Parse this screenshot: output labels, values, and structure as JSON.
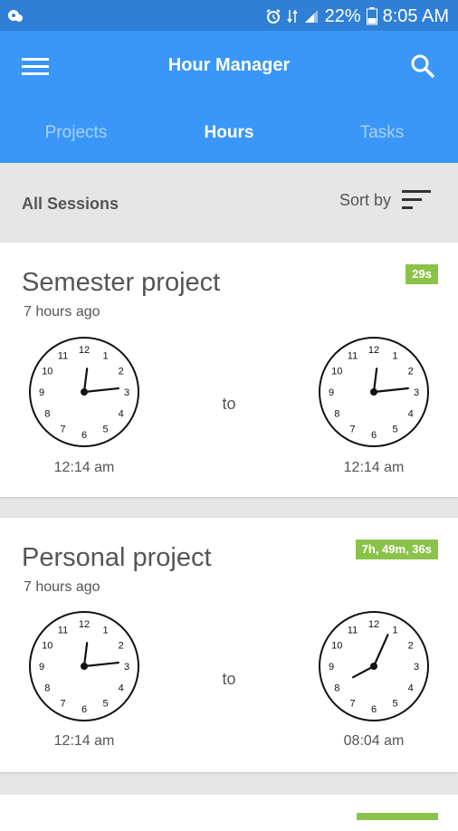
{
  "status_bar": {
    "battery": "22%",
    "time": "8:05 AM"
  },
  "app_bar": {
    "title": "Hour Manager"
  },
  "tabs": [
    {
      "label": "Projects",
      "active": false
    },
    {
      "label": "Hours",
      "active": true
    },
    {
      "label": "Tasks",
      "active": false
    }
  ],
  "sessions": {
    "header": "All Sessions",
    "sort_label": "Sort by",
    "items": [
      {
        "name": "Semester project",
        "ago": "7 hours ago",
        "duration": "29s",
        "start_time": "12:14 am",
        "to_label": "to",
        "end_time": "12:14 am",
        "start_clock": {
          "hours": 12,
          "minutes": 14
        },
        "end_clock": {
          "hours": 12,
          "minutes": 14
        }
      },
      {
        "name": "Personal project",
        "ago": "7 hours ago",
        "duration": "7h, 49m, 36s",
        "start_time": "12:14 am",
        "to_label": "to",
        "end_time": "08:04 am",
        "start_clock": {
          "hours": 12,
          "minutes": 14
        },
        "end_clock": {
          "hours": 8,
          "minutes": 4
        }
      }
    ]
  },
  "colors": {
    "status_bar": "#2f7fd6",
    "app_bar": "#3a97f7",
    "badge": "#8bc34a"
  },
  "icons": {
    "menu": "menu-icon",
    "search": "search-icon",
    "sort": "sort-icon",
    "alarm": "alarm-icon",
    "signal": "signal-icon",
    "battery": "battery-icon"
  }
}
